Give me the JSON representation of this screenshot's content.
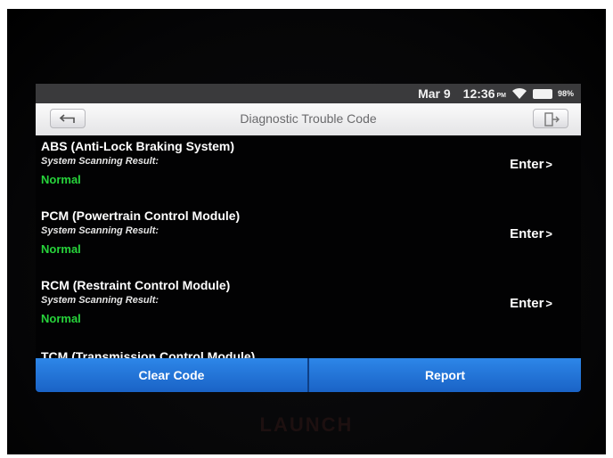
{
  "status_bar": {
    "date": "Mar 9",
    "time": "12:36",
    "ampm": "PM",
    "battery": "98%",
    "icons": [
      "wifi-icon",
      "battery-icon"
    ]
  },
  "header": {
    "title": "Diagnostic Trouble Code",
    "back_icon": "back-arrow-icon",
    "exit_icon": "exit-icon"
  },
  "modules": [
    {
      "name": "ABS (Anti-Lock Braking System)",
      "scan_label": "System Scanning Result:",
      "result": "Normal",
      "action": "Enter"
    },
    {
      "name": "PCM (Powertrain Control Module)",
      "scan_label": "System Scanning Result:",
      "result": "Normal",
      "action": "Enter"
    },
    {
      "name": "RCM (Restraint Control Module)",
      "scan_label": "System Scanning Result:",
      "result": "Normal",
      "action": "Enter"
    },
    {
      "name": "TCM (Transmission Control Module)"
    }
  ],
  "footer": {
    "clear_label": "Clear Code",
    "report_label": "Report"
  },
  "device": {
    "logo": "LAUNCH"
  },
  "colors": {
    "accent_blue": "#2178dc",
    "normal_green": "#27d43b"
  }
}
